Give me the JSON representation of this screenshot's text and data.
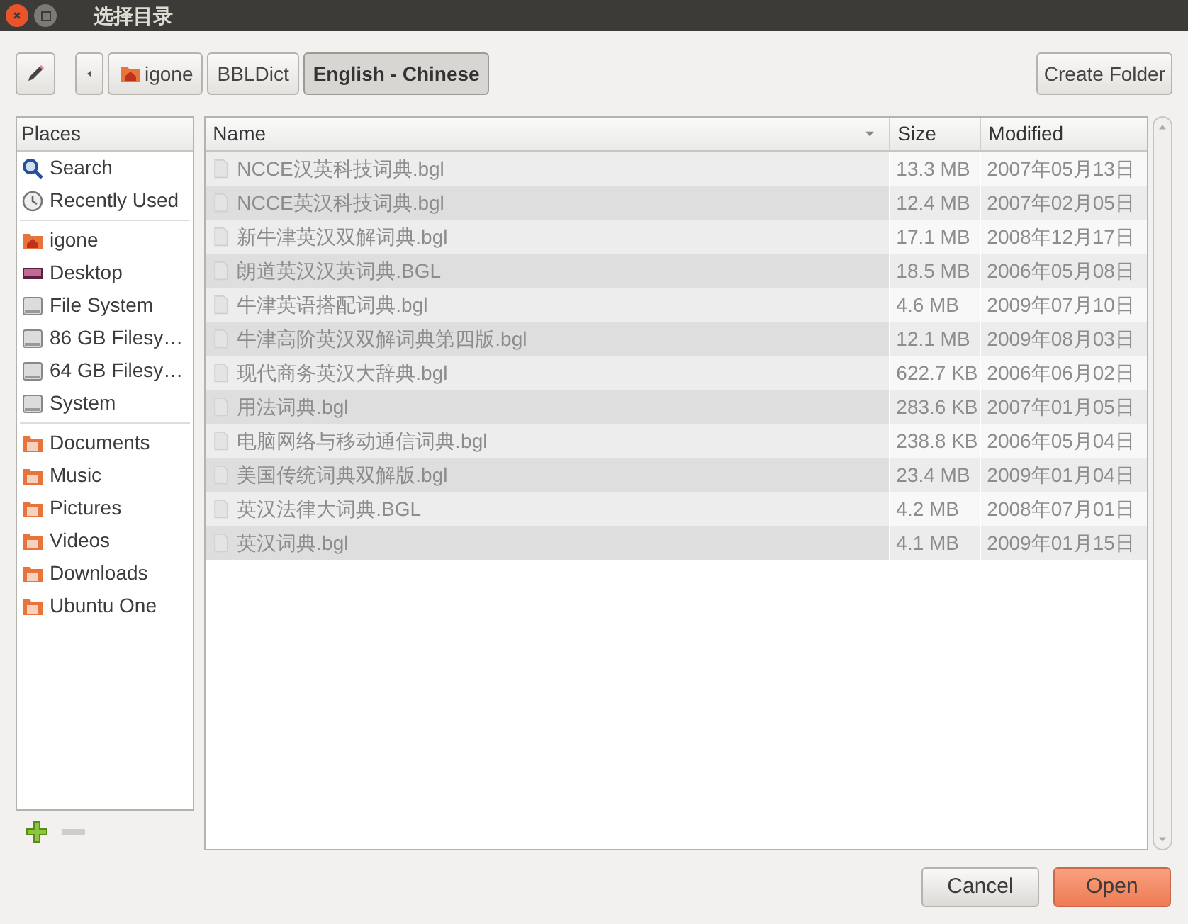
{
  "window": {
    "title": "选择目录"
  },
  "path_bar": [
    {
      "label": "igone",
      "kind": "home",
      "selected": false
    },
    {
      "label": "BBLDict",
      "kind": "plain",
      "selected": false
    },
    {
      "label": "English - Chinese",
      "kind": "plain",
      "selected": true
    }
  ],
  "create_folder_button": "Create Folder",
  "places": {
    "header": "Places",
    "groups": [
      [
        {
          "label": "Search",
          "kind": "search"
        },
        {
          "label": "Recently Used",
          "kind": "recent"
        }
      ],
      [
        {
          "label": "igone",
          "kind": "home"
        },
        {
          "label": "Desktop",
          "kind": "desktop"
        },
        {
          "label": "File System",
          "kind": "drive"
        },
        {
          "label": "86 GB Filesy…",
          "kind": "drive"
        },
        {
          "label": "64 GB Filesy…",
          "kind": "drive"
        },
        {
          "label": "System",
          "kind": "drive"
        }
      ],
      [
        {
          "label": "Documents",
          "kind": "folder"
        },
        {
          "label": "Music",
          "kind": "folder"
        },
        {
          "label": "Pictures",
          "kind": "folder"
        },
        {
          "label": "Videos",
          "kind": "folder"
        },
        {
          "label": "Downloads",
          "kind": "folder"
        },
        {
          "label": "Ubuntu One",
          "kind": "folder"
        }
      ]
    ]
  },
  "table": {
    "columns": [
      "Name",
      "Size",
      "Modified"
    ],
    "rows": [
      {
        "name": "NCCE汉英科技词典.bgl",
        "size": "13.3 MB",
        "modified": "2007年05月13日",
        "disabled": true
      },
      {
        "name": "NCCE英汉科技词典.bgl",
        "size": "12.4 MB",
        "modified": "2007年02月05日",
        "disabled": true
      },
      {
        "name": "新牛津英汉双解词典.bgl",
        "size": "17.1 MB",
        "modified": "2008年12月17日",
        "disabled": true
      },
      {
        "name": "朗道英汉汉英词典.BGL",
        "size": "18.5 MB",
        "modified": "2006年05月08日",
        "disabled": true
      },
      {
        "name": "牛津英语搭配词典.bgl",
        "size": "4.6 MB",
        "modified": "2009年07月10日",
        "disabled": true
      },
      {
        "name": "牛津高阶英汉双解词典第四版.bgl",
        "size": "12.1 MB",
        "modified": "2009年08月03日",
        "disabled": true
      },
      {
        "name": "现代商务英汉大辞典.bgl",
        "size": "622.7 KB",
        "modified": "2006年06月02日",
        "disabled": true
      },
      {
        "name": "用法词典.bgl",
        "size": "283.6 KB",
        "modified": "2007年01月05日",
        "disabled": true
      },
      {
        "name": "电脑网络与移动通信词典.bgl",
        "size": "238.8 KB",
        "modified": "2006年05月04日",
        "disabled": true
      },
      {
        "name": "美国传统词典双解版.bgl",
        "size": "23.4 MB",
        "modified": "2009年01月04日",
        "disabled": true
      },
      {
        "name": "英汉法律大词典.BGL",
        "size": "4.2 MB",
        "modified": "2008年07月01日",
        "disabled": true
      },
      {
        "name": "英汉词典.bgl",
        "size": "4.1 MB",
        "modified": "2009年01月15日",
        "disabled": true
      }
    ]
  },
  "buttons": [
    {
      "label": "Cancel",
      "kind": "secondary"
    },
    {
      "label": "Open",
      "kind": "primary"
    }
  ]
}
